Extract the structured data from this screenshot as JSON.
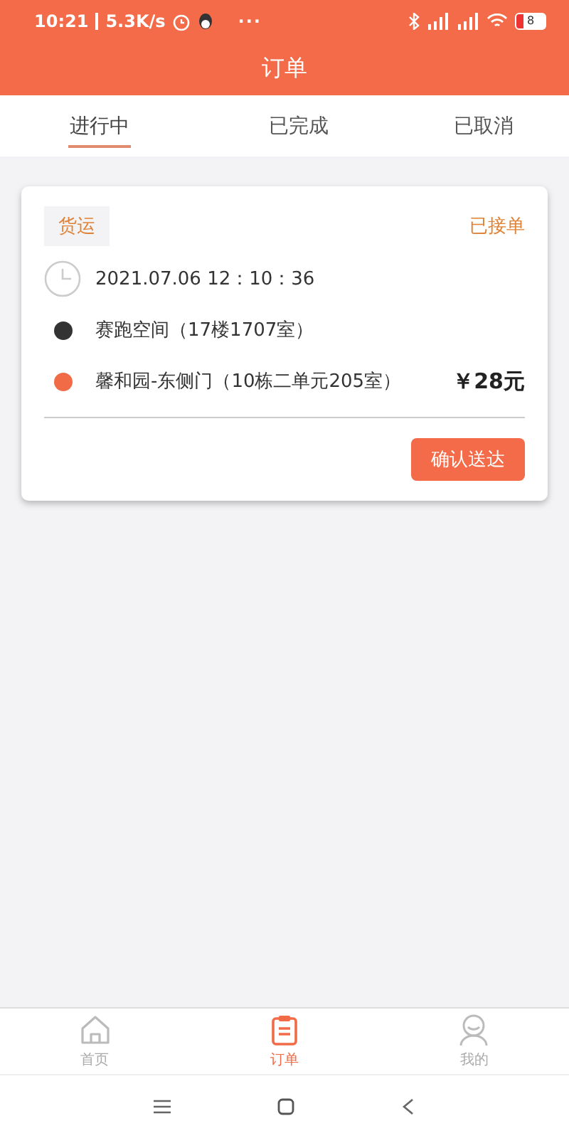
{
  "status_bar": {
    "time": "10:21",
    "speed": "5.3K/s",
    "more": "···",
    "battery": "8"
  },
  "title": "订单",
  "tabs": [
    {
      "label": "进行中",
      "selected": true
    },
    {
      "label": "已完成",
      "selected": false
    },
    {
      "label": "已取消",
      "selected": false
    }
  ],
  "orders": [
    {
      "tag": "货运",
      "status": "已接单",
      "time": "2021.07.06 12：10：36",
      "stops": [
        {
          "address": "赛跑空间（17楼1707室）",
          "color": "#333333"
        },
        {
          "address": "馨和园-东侧门（10栋二单元205室）",
          "color": "#f26b47"
        }
      ],
      "price": "￥28元",
      "action": "确认送达"
    }
  ],
  "nav": [
    {
      "label": "首页",
      "kind": "home",
      "selected": false
    },
    {
      "label": "订单",
      "kind": "orders",
      "selected": true
    },
    {
      "label": "我的",
      "kind": "profile",
      "selected": false
    }
  ]
}
